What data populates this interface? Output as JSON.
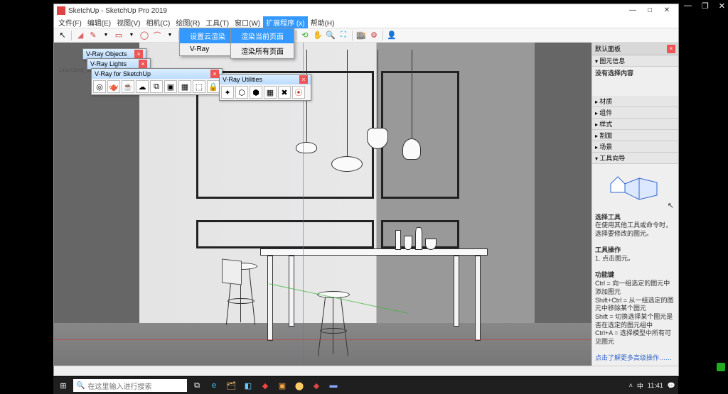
{
  "app": {
    "title": "SketchUp - SketchUp Pro 2019",
    "window_buttons": {
      "min": "—",
      "max": "□",
      "close": "✕"
    }
  },
  "menubar": {
    "items": [
      "文件(F)",
      "编辑(E)",
      "视图(V)",
      "相机(C)",
      "绘图(R)",
      "工具(T)",
      "窗口(W)",
      "扩展程序 (x)",
      "帮助(H)"
    ],
    "open_index": 7
  },
  "dropdown1": {
    "items": [
      {
        "label": "设置云渲染",
        "sub": true
      },
      {
        "label": "V-Ray",
        "sub": true
      }
    ]
  },
  "dropdown2": {
    "items": [
      {
        "label": "渲染当前页面",
        "hl": true
      },
      {
        "label": "渲染所有页面"
      }
    ]
  },
  "panels": {
    "vray_objects": {
      "title": "V-Ray Objects"
    },
    "vray_lights": {
      "title": "V-Ray Lights"
    },
    "vray_main": {
      "title": "V-Ray for SketchUp"
    },
    "vray_util": {
      "title": "V-Ray Utilities"
    }
  },
  "side": {
    "header": "默认面板",
    "section_info": "图元信息",
    "no_selection": "没有选择内容",
    "sections": [
      "材质",
      "组件",
      "样式",
      "割面",
      "场景",
      "工具向导"
    ],
    "instructor": {
      "title": "选择工具",
      "desc1": "在使用其他工具或命令时，选择要修改的图元。",
      "op_title": "工具操作",
      "op1": "1. 点击图元。",
      "fn_title": "功能键",
      "fn1": "Ctrl = 向一组选定的图元中添加图元",
      "fn2": "Shift+Ctrl = 从一组选定的图元中移除某个图元",
      "fn3": "Shift = 切换选择某个图元是否在选定的图元组中",
      "fn4": "Ctrl+A = 选择模型中所有可见图元",
      "link": "点击了解更多高级操作……"
    }
  },
  "viewport": {
    "camera_label": "1standard_Camera"
  },
  "taskbar": {
    "search_placeholder": "在这里输入进行搜索",
    "time": "11:41"
  },
  "outer_controls": {
    "min": "—",
    "max": "❐",
    "close": "✕"
  }
}
